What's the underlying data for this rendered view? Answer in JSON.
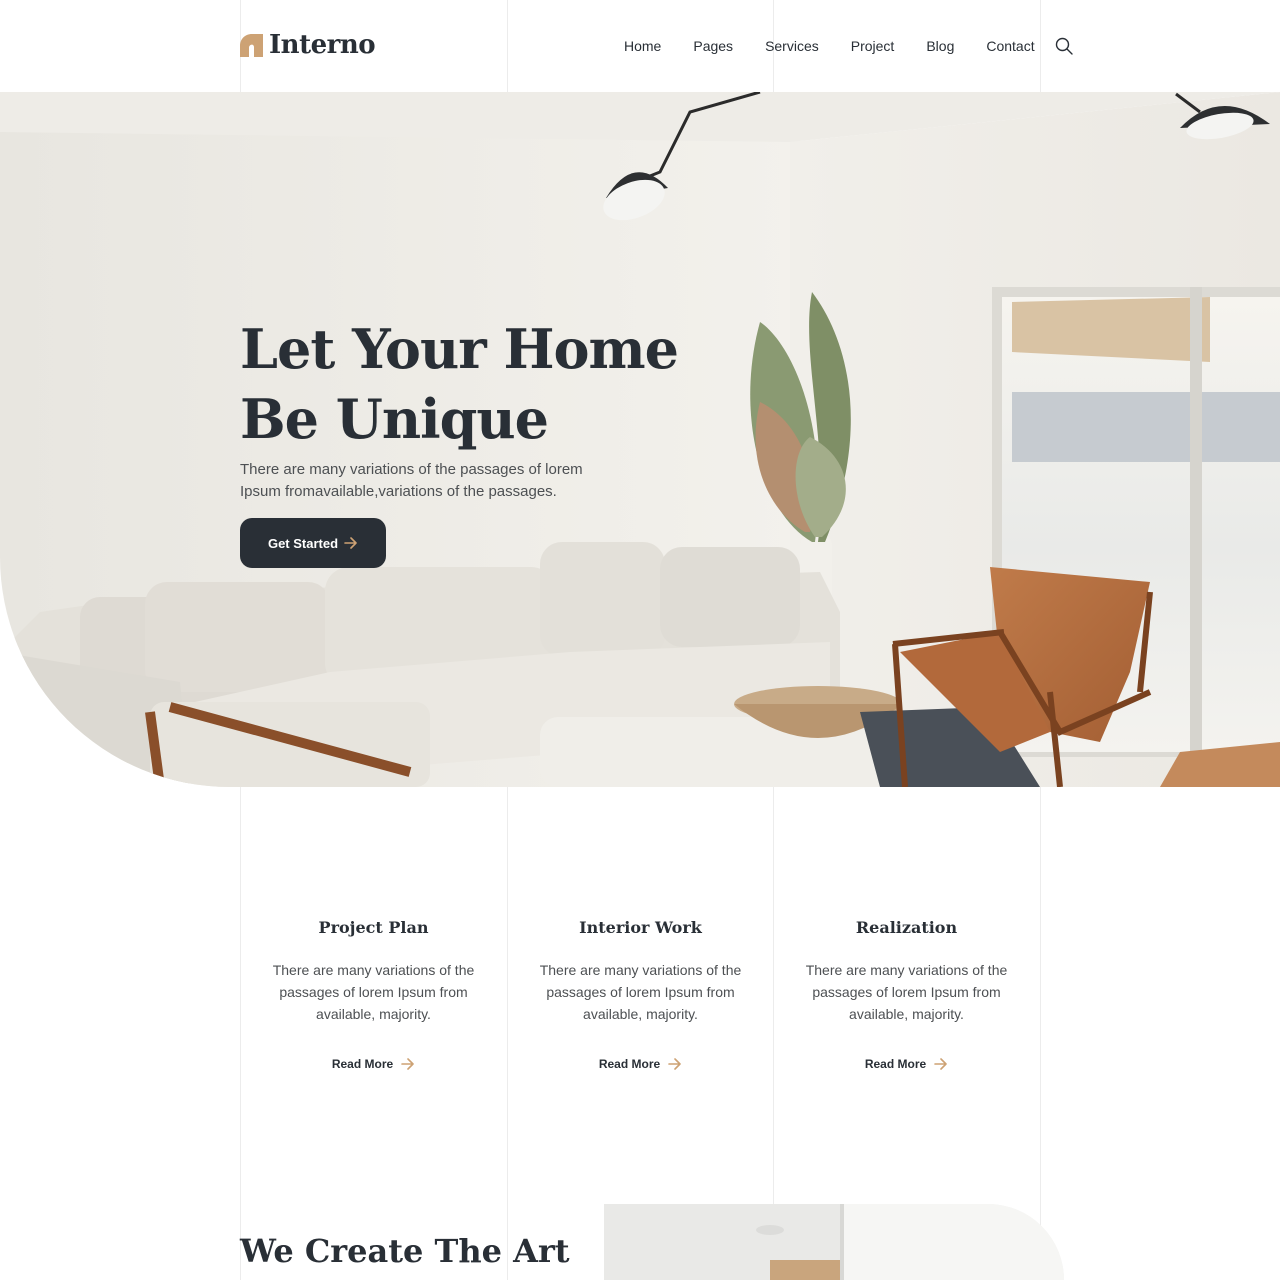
{
  "brand": {
    "name": "Interno",
    "accent_color": "#cda274",
    "dark_color": "#292f36"
  },
  "nav": {
    "items": [
      "Home",
      "Pages",
      "Services",
      "Project",
      "Blog",
      "Contact"
    ],
    "search_icon": "search-icon"
  },
  "hero": {
    "title_line1": "Let Your Home",
    "title_line2": "Be Unique",
    "text": "There are many variations of the passages of lorem Ipsum fromavailable,variations of the passages.",
    "button_label": "Get Started",
    "button_icon": "arrow-right-icon"
  },
  "services": [
    {
      "title": "Project Plan",
      "text": "There are many variations of the passages of lorem Ipsum from available, majority.",
      "link": "Read More"
    },
    {
      "title": "Interior Work",
      "text": "There are many variations of the passages of lorem Ipsum from available, majority.",
      "link": "Read More"
    },
    {
      "title": "Realization",
      "text": "There are many variations of the passages of lorem Ipsum from available, majority.",
      "link": "Read More"
    }
  ],
  "about": {
    "title": "We Create The Art"
  }
}
